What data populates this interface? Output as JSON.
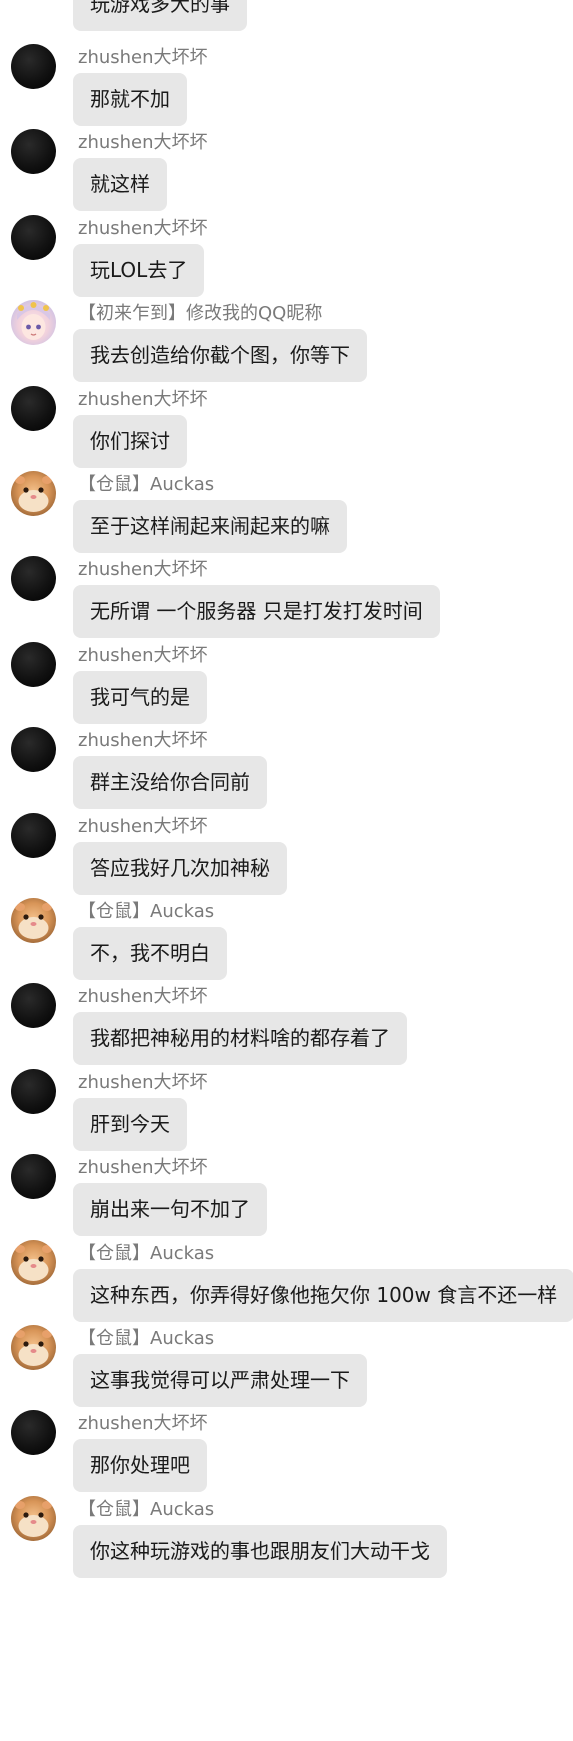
{
  "previous_message": {
    "text": "玩游戏多大的事"
  },
  "messages": [
    {
      "sender": "zhushen大坏坏",
      "avatar": "dark-avatar",
      "text": "那就不加"
    },
    {
      "sender": "zhushen大坏坏",
      "avatar": "dark-avatar",
      "text": "就这样"
    },
    {
      "sender": "zhushen大坏坏",
      "avatar": "dark-avatar",
      "text": "玩LOL去了"
    },
    {
      "sender": "【初来乍到】修改我的QQ昵称",
      "avatar": "anime-avatar",
      "text": "我去创造给你截个图，你等下"
    },
    {
      "sender": "zhushen大坏坏",
      "avatar": "dark-avatar",
      "text": "你们探讨"
    },
    {
      "sender": "【仓鼠】Auckas",
      "avatar": "hamster-avatar",
      "text": "至于这样闹起来闹起来的嘛"
    },
    {
      "sender": "zhushen大坏坏",
      "avatar": "dark-avatar",
      "text": "无所谓 一个服务器 只是打发打发时间"
    },
    {
      "sender": "zhushen大坏坏",
      "avatar": "dark-avatar",
      "text": "我可气的是"
    },
    {
      "sender": "zhushen大坏坏",
      "avatar": "dark-avatar",
      "text": "群主没给你合同前"
    },
    {
      "sender": "zhushen大坏坏",
      "avatar": "dark-avatar",
      "text": "答应我好几次加神秘"
    },
    {
      "sender": "【仓鼠】Auckas",
      "avatar": "hamster-avatar",
      "text": "不，我不明白"
    },
    {
      "sender": "zhushen大坏坏",
      "avatar": "dark-avatar",
      "text": "我都把神秘用的材料啥的都存着了"
    },
    {
      "sender": "zhushen大坏坏",
      "avatar": "dark-avatar",
      "text": "肝到今天"
    },
    {
      "sender": "zhushen大坏坏",
      "avatar": "dark-avatar",
      "text": "崩出来一句不加了"
    },
    {
      "sender": "【仓鼠】Auckas",
      "avatar": "hamster-avatar",
      "text": "这种东西，你弄得好像他拖欠你 100w 食言不还一样"
    },
    {
      "sender": "【仓鼠】Auckas",
      "avatar": "hamster-avatar",
      "text": "这事我觉得可以严肃处理一下"
    },
    {
      "sender": "zhushen大坏坏",
      "avatar": "dark-avatar",
      "text": "那你处理吧"
    },
    {
      "sender": "【仓鼠】Auckas",
      "avatar": "hamster-avatar",
      "text": "你这种玩游戏的事也跟朋友们大动干戈"
    }
  ]
}
